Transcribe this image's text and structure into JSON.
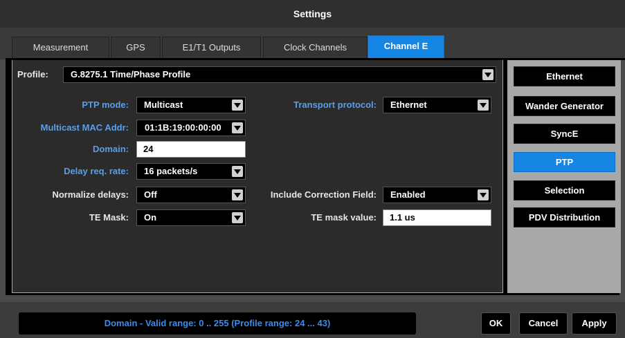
{
  "window": {
    "title": "Settings"
  },
  "tabs": [
    {
      "label": "Measurement"
    },
    {
      "label": "GPS"
    },
    {
      "label": "E1/T1 Outputs"
    },
    {
      "label": "Clock Channels"
    },
    {
      "label": "Channel E",
      "active": true
    }
  ],
  "profile": {
    "label": "Profile:",
    "value": "G.8275.1 Time/Phase Profile"
  },
  "fields": {
    "ptp_mode": {
      "label": "PTP mode:",
      "value": "Multicast"
    },
    "multicast_mac": {
      "label": "Multicast MAC Addr:",
      "value": "01:1B:19:00:00:00"
    },
    "domain": {
      "label": "Domain:",
      "value": "24"
    },
    "delay_req_rate": {
      "label": "Delay req. rate:",
      "value": "16 packets/s"
    },
    "normalize_delays": {
      "label": "Normalize delays:",
      "value": "Off"
    },
    "te_mask": {
      "label": "TE Mask:",
      "value": "On"
    },
    "transport_protocol": {
      "label": "Transport protocol:",
      "value": "Ethernet"
    },
    "include_correction_field": {
      "label": "Include Correction Field:",
      "value": "Enabled"
    },
    "te_mask_value": {
      "label": "TE mask value:",
      "value": "1.1 us"
    }
  },
  "side_buttons": [
    {
      "label": "Ethernet"
    },
    {
      "label": "Wander Generator"
    },
    {
      "label": "SyncE"
    },
    {
      "label": "PTP",
      "active": true
    },
    {
      "label": "Selection"
    },
    {
      "label": "PDV Distribution"
    }
  ],
  "status": {
    "text": "Domain - Valid range: 0 .. 255 (Profile range: 24 ... 43)"
  },
  "footer": {
    "ok_label": "OK",
    "cancel_label": "Cancel",
    "apply_label": "Apply"
  },
  "colors": {
    "accent": "#1686e4",
    "blue_label": "#5b9ee8",
    "status_text": "#3a8cf0"
  }
}
